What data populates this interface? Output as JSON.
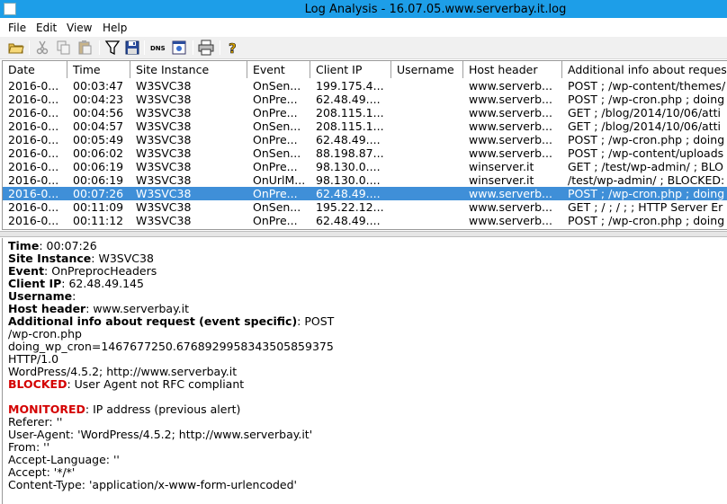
{
  "window": {
    "title": "Log Analysis - 16.07.05.www.serverbay.it.log"
  },
  "menu": [
    {
      "key": "file",
      "label": "File"
    },
    {
      "key": "edit",
      "label": "Edit"
    },
    {
      "key": "view",
      "label": "View"
    },
    {
      "key": "help",
      "label": "Help"
    }
  ],
  "toolbar": {
    "buttons": [
      {
        "icon": "open-folder-icon"
      },
      {
        "icon": "cut-icon"
      },
      {
        "icon": "copy-icon"
      },
      {
        "icon": "paste-icon"
      },
      {
        "icon": "filter-icon"
      },
      {
        "icon": "save-icon"
      },
      {
        "icon": "dns-icon",
        "label": "DNS"
      },
      {
        "icon": "properties-icon"
      },
      {
        "icon": "print-icon"
      },
      {
        "icon": "help-icon",
        "label": "?"
      }
    ]
  },
  "table": {
    "columns": [
      "Date",
      "Time",
      "Site Instance",
      "Event",
      "Client IP",
      "Username",
      "Host header",
      "Additional info about request"
    ],
    "rows": [
      [
        "2016-0...",
        "00:03:47",
        "W3SVC38",
        "OnSen...",
        "199.175.4...",
        "",
        "www.serverb...",
        "POST ; /wp-content/themes/"
      ],
      [
        "2016-0...",
        "00:04:23",
        "W3SVC38",
        "OnPre...",
        "62.48.49....",
        "",
        "www.serverb...",
        "POST ; /wp-cron.php ; doing"
      ],
      [
        "2016-0...",
        "00:04:56",
        "W3SVC38",
        "OnPre...",
        "208.115.1...",
        "",
        "www.serverb...",
        "GET ; /blog/2014/10/06/atti"
      ],
      [
        "2016-0...",
        "00:04:57",
        "W3SVC38",
        "OnSen...",
        "208.115.1...",
        "",
        "www.serverb...",
        "GET ; /blog/2014/10/06/atti"
      ],
      [
        "2016-0...",
        "00:05:49",
        "W3SVC38",
        "OnPre...",
        "62.48.49....",
        "",
        "www.serverb...",
        "POST ; /wp-cron.php ; doing"
      ],
      [
        "2016-0...",
        "00:06:02",
        "W3SVC38",
        "OnSen...",
        "88.198.87...",
        "",
        "www.serverb...",
        "POST ; /wp-content/uploads"
      ],
      [
        "2016-0...",
        "00:06:19",
        "W3SVC38",
        "OnPre...",
        "98.130.0....",
        "",
        "winserver.it",
        "GET ; /test/wp-admin/ ; BLO"
      ],
      [
        "2016-0...",
        "00:06:19",
        "W3SVC38",
        "OnUrlM...",
        "98.130.0....",
        "",
        "winserver.it",
        "/test/wp-admin/ ; BLOCKED:"
      ],
      [
        "2016-0...",
        "00:07:26",
        "W3SVC38",
        "OnPre...",
        "62.48.49....",
        "",
        "www.serverb...",
        "POST ; /wp-cron.php ; doing"
      ],
      [
        "2016-0...",
        "00:11:09",
        "W3SVC38",
        "OnSen...",
        "195.22.12...",
        "",
        "www.serverb...",
        "GET ; / ; / ;  ; HTTP Server Er"
      ],
      [
        "2016-0...",
        "00:11:12",
        "W3SVC38",
        "OnPre...",
        "62.48.49....",
        "",
        "www.serverb...",
        "POST ; /wp-cron.php ; doing"
      ]
    ],
    "selected_index": 8
  },
  "details": {
    "time_label": "Time",
    "time_value": "00:07:26",
    "site_label": "Site Instance",
    "site_value": "W3SVC38",
    "event_label": "Event",
    "event_value": "OnPreprocHeaders",
    "ip_label": "Client IP",
    "ip_value": "62.48.49.145",
    "user_label": "Username",
    "user_value": "",
    "host_label": "Host header",
    "host_value": "www.serverbay.it",
    "info_label": "Additional info about request (event specific)",
    "info_value": "POST",
    "info_lines": [
      "/wp-cron.php",
      "doing_wp_cron=1467677250.6768929958343505859375",
      "HTTP/1.0",
      "WordPress/4.5.2; http://www.serverbay.it"
    ],
    "blocked_label": "BLOCKED",
    "blocked_value": "User Agent not RFC compliant",
    "monitored_label": "MONITORED",
    "monitored_value": "IP address (previous alert)",
    "header_lines": [
      "Referer: ''",
      "User-Agent: 'WordPress/4.5.2; http://www.serverbay.it'",
      "From: ''",
      "Accept-Language: ''",
      "Accept: '*/*'",
      "Content-Type: 'application/x-www-form-urlencoded'"
    ]
  },
  "colors": {
    "titlebar": "#1d9ee8",
    "selection": "#3f8fd8",
    "alert": "#d40000"
  }
}
